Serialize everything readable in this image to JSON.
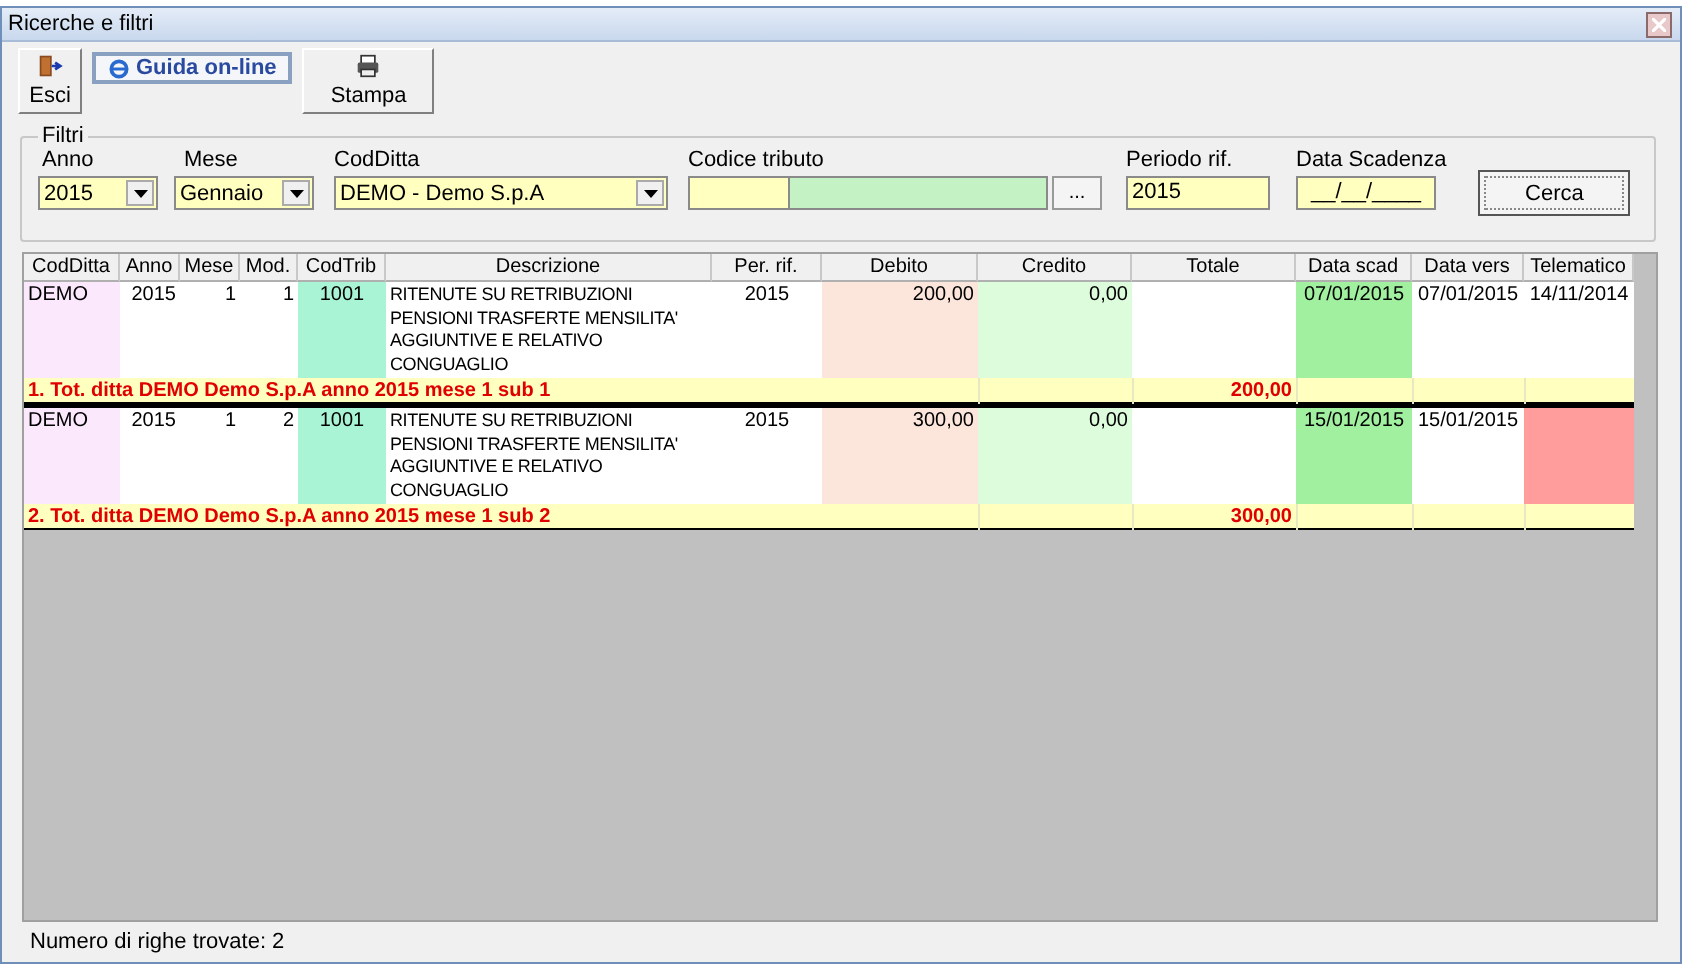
{
  "window": {
    "title": "Ricerche e filtri"
  },
  "toolbar": [
    {
      "kind": "exit",
      "label": "Esci"
    },
    {
      "kind": "help",
      "label": "Guida on-line"
    },
    {
      "kind": "print",
      "label": "Stampa"
    }
  ],
  "filters": {
    "title": "Filtri",
    "fields": [
      {
        "kind": "combo",
        "label": "Anno",
        "value": "2015"
      },
      {
        "kind": "combo",
        "label": "Mese",
        "value": "Gennaio"
      },
      {
        "kind": "combo",
        "label": "CodDitta",
        "value": "DEMO - Demo S.p.A"
      },
      {
        "kind": "lookup",
        "label": "Codice tributo",
        "button": "..."
      },
      {
        "kind": "text",
        "label": "Periodo rif.",
        "value": "2015"
      },
      {
        "kind": "date",
        "label": "Data Scadenza",
        "value": "__/__/____"
      }
    ],
    "search_button": "Cerca"
  },
  "table": {
    "columns": [
      "CodDitta",
      "Anno",
      "Mese",
      "Mod.",
      "CodTrib",
      "Descrizione",
      "Per. rif.",
      "Debito",
      "Credito",
      "Totale",
      "Data scad",
      "Data vers",
      "Telematico"
    ],
    "rows": [
      {
        "kind": "data",
        "cells": [
          "DEMO",
          "2015",
          "1",
          "1",
          "1001",
          "RITENUTE SU RETRIBUZIONI  PENSIONI TRASFERTE MENSILITA' AGGIUNTIVE E RELATIVO CONGUAGLIO",
          "2015",
          "200,00",
          "0,00",
          "",
          "07/01/2015",
          "07/01/2015",
          "14/11/2014"
        ],
        "telematico_sent": true
      },
      {
        "kind": "total",
        "label": "1. Tot. ditta DEMO Demo S.p.A  anno 2015 mese 1 sub 1",
        "total": "200,00"
      },
      {
        "kind": "data",
        "cells": [
          "DEMO",
          "2015",
          "1",
          "2",
          "1001",
          "RITENUTE SU RETRIBUZIONI  PENSIONI TRASFERTE MENSILITA' AGGIUNTIVE E RELATIVO CONGUAGLIO",
          "2015",
          "300,00",
          "0,00",
          "",
          "15/01/2015",
          "15/01/2015",
          ""
        ],
        "telematico_sent": false
      },
      {
        "kind": "total",
        "label": "2. Tot. ditta DEMO Demo S.p.A  anno 2015 mese 1 sub 2",
        "total": "300,00"
      }
    ]
  },
  "status_bar": "Numero di righe trovate: 2"
}
